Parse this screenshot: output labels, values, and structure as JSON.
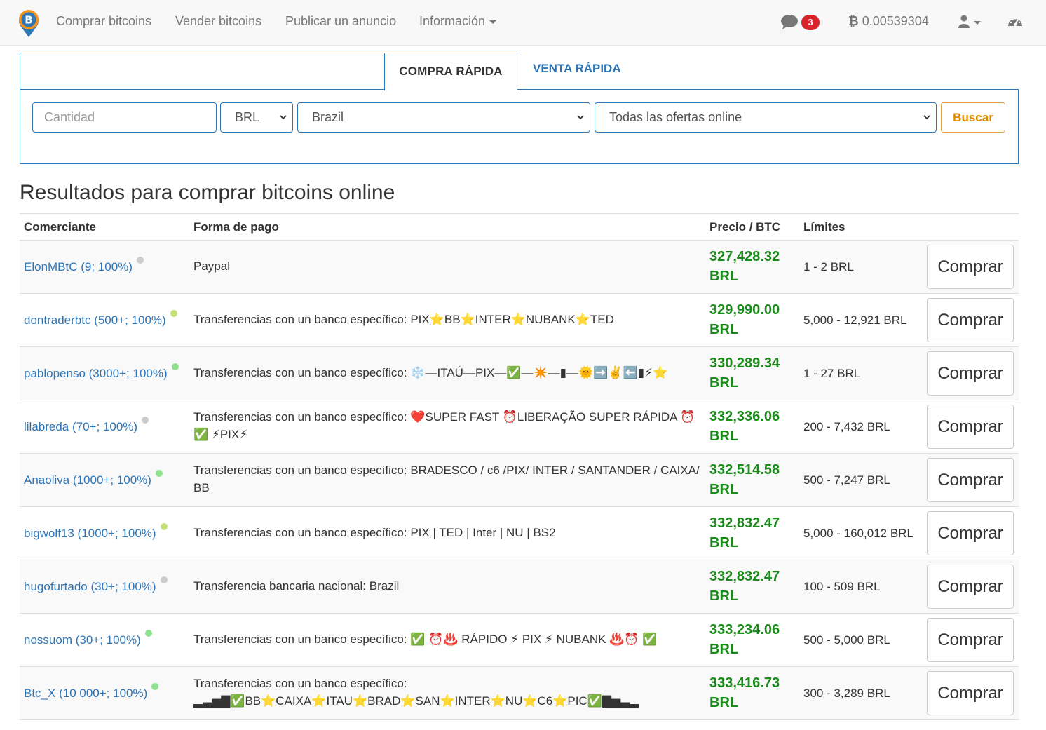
{
  "nav": {
    "buy": "Comprar bitcoins",
    "sell": "Vender bitcoins",
    "publish": "Publicar un anuncio",
    "info": "Información",
    "messages_count": "3",
    "balance": "0.00539304"
  },
  "quick": {
    "tab_buy": "COMPRA RÁPIDA",
    "tab_sell": "VENTA RÁPIDA",
    "amount_placeholder": "Cantidad",
    "currency": "BRL",
    "country": "Brazil",
    "offers": "Todas las ofertas online",
    "search": "Buscar"
  },
  "results": {
    "title": "Resultados para comprar bitcoins online",
    "headers": {
      "trader": "Comerciante",
      "payment": "Forma de pago",
      "price": "Precio / BTC",
      "limits": "Límites"
    },
    "buy_label": "Comprar",
    "rows": [
      {
        "trader": "ElonMBtC (9; 100%)",
        "payment": "Paypal",
        "price": "327,428.32",
        "currency": "BRL",
        "limits": "1 - 2 BRL",
        "status": "#cccccc"
      },
      {
        "trader": "dontraderbtc (500+; 100%)",
        "payment": "Transferencias con un banco específico: PIX⭐BB⭐INTER⭐NUBANK⭐TED",
        "price": "329,990.00",
        "currency": "BRL",
        "limits": "5,000 - 12,921 BRL",
        "status": "#c8e07a"
      },
      {
        "trader": "pablopenso (3000+; 100%)",
        "payment": "Transferencias con un banco específico: ❄️—ITAÚ—PIX—✅—✴️—▮—🌞➡️✌️⬅️▮⚡⭐",
        "price": "330,289.34",
        "currency": "BRL",
        "limits": "1 - 27 BRL",
        "status": "#8fe08f"
      },
      {
        "trader": "lilabreda (70+; 100%)",
        "payment": "Transferencias con un banco específico: ❤️SUPER FAST ⏰LIBERAÇÃO SUPER RÁPIDA ⏰ ✅ ⚡PIX⚡",
        "price": "332,336.06",
        "currency": "BRL",
        "limits": "200 - 7,432 BRL",
        "status": "#cccccc"
      },
      {
        "trader": "Anaoliva (1000+; 100%)",
        "payment": "Transferencias con un banco específico: BRADESCO / c6 /PIX/ INTER / SANTANDER / CAIXA/ BB",
        "price": "332,514.58",
        "currency": "BRL",
        "limits": "500 - 7,247 BRL",
        "status": "#8fe08f"
      },
      {
        "trader": "bigwolf13 (1000+; 100%)",
        "payment": "Transferencias con un banco específico: PIX | TED | Inter | NU | BS2",
        "price": "332,832.47",
        "currency": "BRL",
        "limits": "5,000 - 160,012 BRL",
        "status": "#c8e07a"
      },
      {
        "trader": "hugofurtado (30+; 100%)",
        "payment": "Transferencia bancaria nacional: Brazil",
        "price": "332,832.47",
        "currency": "BRL",
        "limits": "100 - 509 BRL",
        "status": "#cccccc"
      },
      {
        "trader": "nossuom (30+; 100%)",
        "payment": "Transferencias con un banco específico: ✅ ⏰♨️ RÁPIDO ⚡ PIX ⚡ NUBANK ♨️⏰ ✅",
        "price": "333,234.06",
        "currency": "BRL",
        "limits": "500 - 5,000 BRL",
        "status": "#8fe08f"
      },
      {
        "trader": "Btc_X (10 000+; 100%)",
        "payment": "Transferencias con un banco específico: ▂▃▅▇✅BB⭐CAIXA⭐ITAU⭐BRAD⭐SAN⭐INTER⭐NU⭐C6⭐PIC✅▇▅▃▂",
        "price": "333,416.73",
        "currency": "BRL",
        "limits": "300 - 3,289 BRL",
        "status": "#8fe08f"
      }
    ]
  }
}
